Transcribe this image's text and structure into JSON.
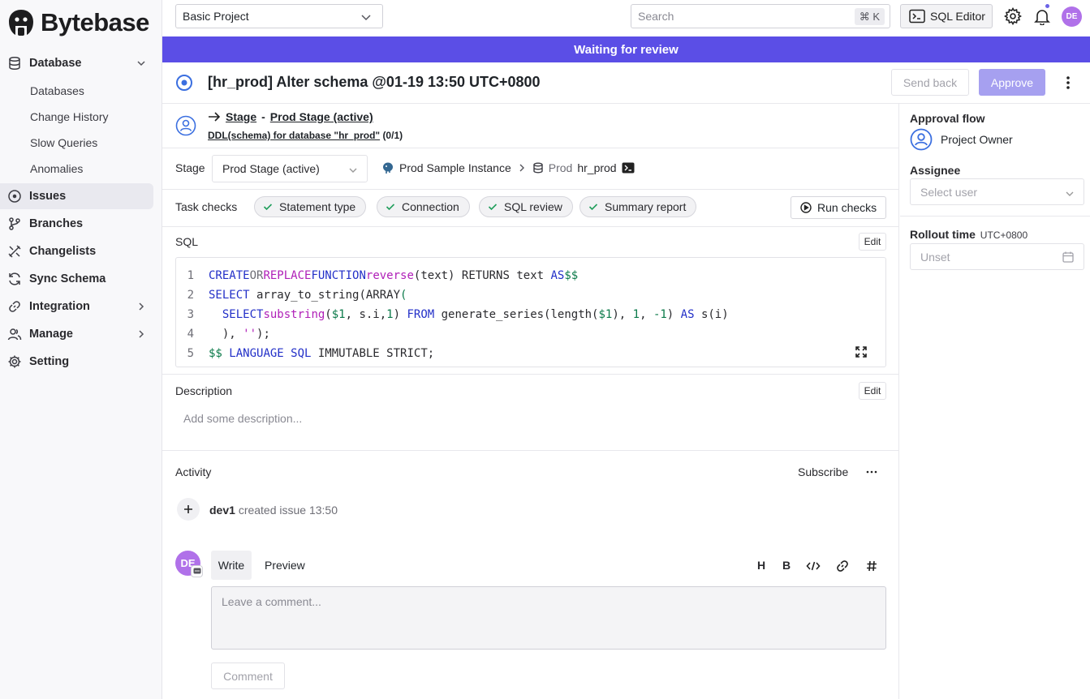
{
  "app": {
    "name": "Bytebase"
  },
  "header": {
    "project": "Basic Project",
    "search_placeholder": "Search",
    "search_shortcut": "⌘ K",
    "sql_editor": "SQL Editor",
    "avatar_initials": "DE"
  },
  "sidebar": {
    "database": "Database",
    "database_sub": [
      "Databases",
      "Change History",
      "Slow Queries",
      "Anomalies"
    ],
    "items": [
      "Issues",
      "Branches",
      "Changelists",
      "Sync Schema",
      "Integration",
      "Manage",
      "Setting"
    ]
  },
  "banner": "Waiting for review",
  "issue": {
    "title": "[hr_prod] Alter schema @01-19 13:50 UTC+0800",
    "send_back": "Send back",
    "approve": "Approve"
  },
  "stage_header": {
    "stage_word": "Stage",
    "dash": "-",
    "stage_name": "Prod Stage (active)",
    "task_link": "DDL(schema) for database \"hr_prod\"",
    "task_count": "(0/1)"
  },
  "stage_row": {
    "label": "Stage",
    "selected": "Prod Stage (active)",
    "instance": "Prod Sample Instance",
    "env": "Prod",
    "database": "hr_prod"
  },
  "task_checks": {
    "label": "Task checks",
    "chips": [
      "Statement type",
      "Connection",
      "SQL review",
      "Summary report"
    ],
    "run": "Run checks"
  },
  "sql": {
    "label": "SQL",
    "edit": "Edit",
    "line_numbers": [
      "1",
      "2",
      "3",
      "4",
      "5"
    ]
  },
  "description": {
    "label": "Description",
    "edit": "Edit",
    "placeholder": "Add some description..."
  },
  "activity": {
    "label": "Activity",
    "subscribe": "Subscribe",
    "event_user": "dev1",
    "event_text": "created issue 13:50",
    "tab_write": "Write",
    "tab_preview": "Preview",
    "toolbar": [
      "H",
      "B"
    ],
    "comment_placeholder": "Leave a comment...",
    "comment_button": "Comment",
    "avatar_initials": "DE"
  },
  "right_panel": {
    "approval_flow": "Approval flow",
    "approver": "Project Owner",
    "assignee": "Assignee",
    "assignee_placeholder": "Select user",
    "rollout_time": "Rollout time",
    "rollout_tz": "UTC+0800",
    "rollout_value": "Unset"
  },
  "colors": {
    "accent": "#5b4ee6",
    "approve": "#a6a0f0",
    "avatar": "#b071e9"
  }
}
